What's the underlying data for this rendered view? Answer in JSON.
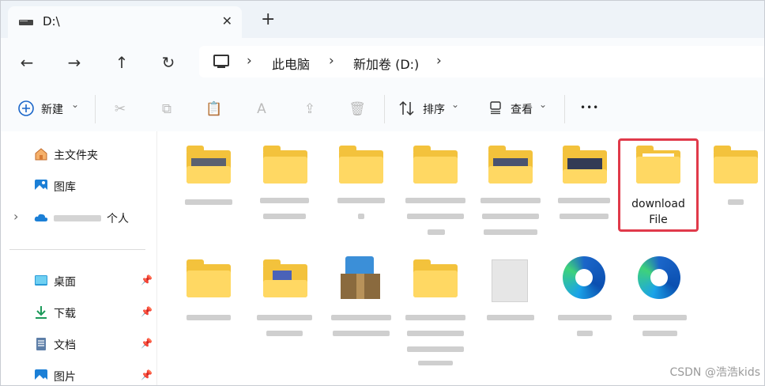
{
  "tab": {
    "title": "D:\\",
    "close": "✕",
    "new_tab": "+"
  },
  "nav": {
    "back": "←",
    "forward": "→",
    "up": "↑",
    "refresh": "↻"
  },
  "address": {
    "sep1": "›",
    "crumb1": "此电脑",
    "sep2": "›",
    "crumb2": "新加卷 (D:)",
    "sep3": "›"
  },
  "toolbar": {
    "new_label": "新建",
    "new_chevron": "⌄",
    "sort_label": "排序",
    "sort_chevron": "⌄",
    "view_label": "查看",
    "view_chevron": "⌄",
    "more": "•••"
  },
  "sidebar": {
    "home": "主文件夹",
    "gallery": "图库",
    "person_suffix": "个人",
    "expand": "›",
    "desktop": "桌面",
    "downloads": "下载",
    "documents": "文档",
    "pictures": "图片",
    "pin": "📌"
  },
  "content": {
    "highlighted_item": {
      "line1": "download",
      "line2": "File"
    }
  },
  "watermark": "CSDN @浩浩kids",
  "colors": {
    "highlight": "#e03a4a",
    "folder": "#ffd863",
    "accent": "#1b66c9"
  }
}
